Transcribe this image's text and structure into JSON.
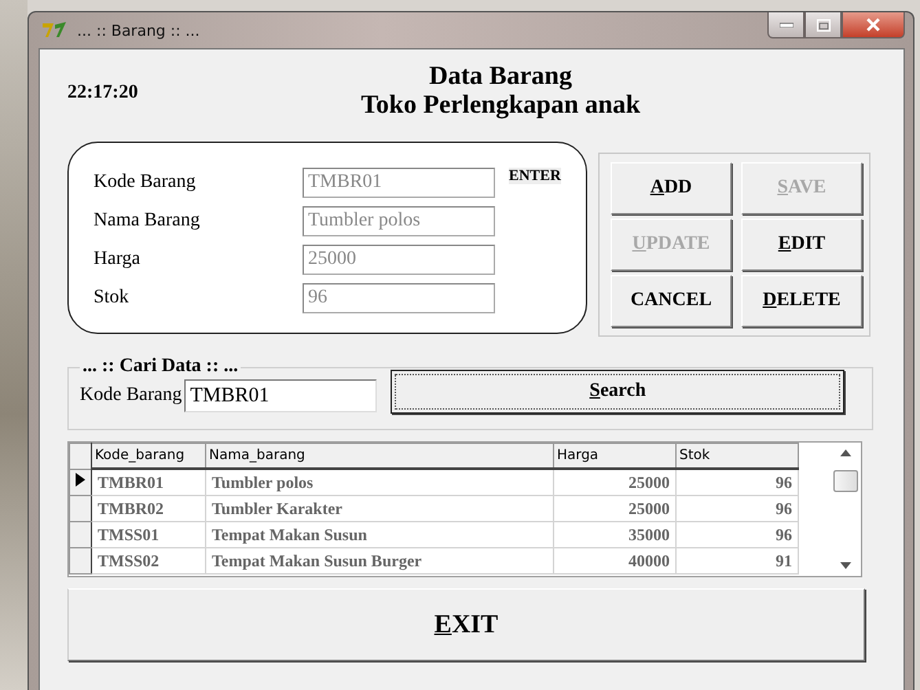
{
  "window": {
    "title": "... :: Barang :: ..."
  },
  "clock": "22:17:20",
  "heading": [
    "Data Barang",
    "Toko Perlengkapan anak"
  ],
  "form": {
    "fields": [
      {
        "label": "Kode Barang",
        "value": "TMBR01"
      },
      {
        "label": "Nama Barang",
        "value": "Tumbler polos"
      },
      {
        "label": "Harga",
        "value": "25000"
      },
      {
        "label": "Stok",
        "value": "96"
      }
    ],
    "enter_label": "ENTER"
  },
  "buttons": [
    {
      "label": "ADD",
      "underline_first": true,
      "disabled": false
    },
    {
      "label": "SAVE",
      "underline_first": true,
      "disabled": true
    },
    {
      "label": "UPDATE",
      "underline_first": true,
      "disabled": true
    },
    {
      "label": "EDIT",
      "underline_first": true,
      "disabled": false
    },
    {
      "label": "CANCEL",
      "underline_first": false,
      "disabled": false
    },
    {
      "label": "DELETE",
      "underline_first": true,
      "disabled": false
    }
  ],
  "search": {
    "group_title": "... :: Cari Data :: ...",
    "label": "Kode Barang",
    "value": "TMBR01",
    "button": {
      "label": "Search",
      "underline_first": true
    }
  },
  "table": {
    "columns": [
      "Kode_barang",
      "Nama_barang",
      "Harga",
      "Stok"
    ],
    "rows": [
      {
        "cells": [
          "TMBR01",
          "Tumbler polos",
          "25000",
          "96"
        ],
        "selected": true
      },
      {
        "cells": [
          "TMBR02",
          "Tumbler Karakter",
          "25000",
          "96"
        ],
        "selected": false
      },
      {
        "cells": [
          "TMSS01",
          "Tempat Makan Susun",
          "35000",
          "96"
        ],
        "selected": false
      },
      {
        "cells": [
          "TMSS02",
          "Tempat Makan Susun Burger",
          "40000",
          "91"
        ],
        "selected": false
      }
    ]
  },
  "exit_button": {
    "label": "EXIT",
    "underline_first": true
  }
}
